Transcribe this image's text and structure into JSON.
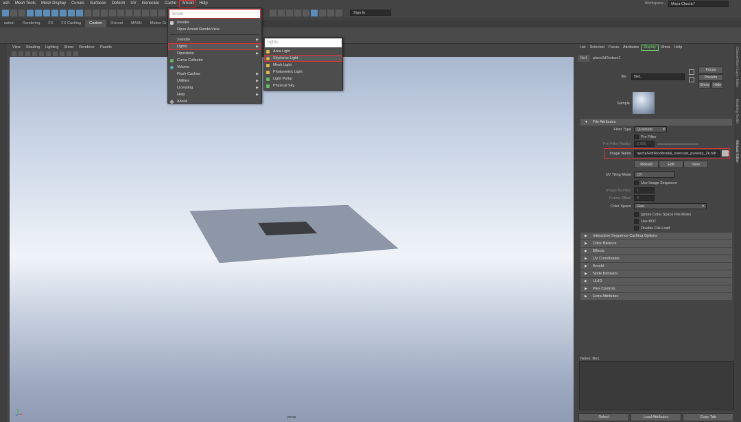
{
  "menubar": {
    "items": [
      "esh",
      "Mesh Tools",
      "Mesh Display",
      "Curves",
      "Surfaces",
      "Deform",
      "UV",
      "Generate",
      "Cache",
      "Arnold",
      "Help"
    ],
    "workspace_label": "Workspace :",
    "workspace_value": "Maya Classic*"
  },
  "toolbar": {
    "signin": "Sign In"
  },
  "shelf_tabs": [
    "eation",
    "Rendering",
    "FX",
    "FX Caching",
    "Custom",
    "Octrost",
    "MASH",
    "Motion Gr"
  ],
  "viewport": {
    "menu": [
      "View",
      "Shading",
      "Lighting",
      "Show",
      "Renderer",
      "Panels"
    ],
    "camera_label": "persp"
  },
  "arnold_menu": {
    "title": "Arnold",
    "items": [
      {
        "label": "Render",
        "icon": "render-icon",
        "arrow": false
      },
      {
        "label": "Open Arnold RenderView",
        "icon": "",
        "arrow": false
      },
      {
        "label": "StandIn",
        "icon": "",
        "arrow": true
      },
      {
        "label": "Lights",
        "icon": "",
        "arrow": true
      },
      {
        "label": "Operators",
        "icon": "",
        "arrow": true
      },
      {
        "label": "Curve Collector",
        "icon": "curve-icon",
        "arrow": false
      },
      {
        "label": "Volume",
        "icon": "volume-icon",
        "arrow": false
      },
      {
        "label": "Flush Caches",
        "icon": "",
        "arrow": true
      },
      {
        "label": "Utilities",
        "icon": "",
        "arrow": true
      },
      {
        "label": "Licensing",
        "icon": "",
        "arrow": true
      },
      {
        "label": "Help",
        "icon": "",
        "arrow": true
      },
      {
        "label": "About",
        "icon": "about-icon",
        "arrow": false
      }
    ]
  },
  "lights_menu": {
    "title": "Lights",
    "items": [
      {
        "label": "Area Light",
        "icon": "area-light-icon"
      },
      {
        "label": "Skydome Light",
        "icon": "skydome-light-icon"
      },
      {
        "label": "Mesh Light",
        "icon": "mesh-light-icon"
      },
      {
        "label": "Photometric Light",
        "icon": "photometric-light-icon"
      },
      {
        "label": "Light Portal",
        "icon": "light-portal-icon"
      },
      {
        "label": "Physical Sky",
        "icon": "physical-sky-icon"
      }
    ]
  },
  "attribute_editor": {
    "menu": [
      "List",
      "Selected",
      "Focus",
      "Attributes",
      "Display",
      "Show",
      "Help"
    ],
    "tabs": [
      "file1",
      "place2dTexture2"
    ],
    "file_label": "file:",
    "file_value": "file1",
    "focus": "Focus",
    "presets": "Presets",
    "show": "Show",
    "hide": "Hide",
    "sample_label": "Sample",
    "file_attributes": "File Attributes",
    "filter_type_label": "Filter Type",
    "filter_type_value": "Quadratic",
    "pre_filter": "Pre Filter",
    "pre_filter_radius_label": "Pre Filter Radius",
    "pre_filter_radius_value": "2.000",
    "image_name_label": "Image Name",
    "image_name_value": "ojects/Hdr/kloofendal_overcast_puresky_2k.hdr",
    "reload": "Reload",
    "edit": "Edit",
    "view": "View",
    "uv_tiling_label": "UV Tiling Mode",
    "uv_tiling_value": "Off",
    "use_image_sequence": "Use Image Sequence",
    "image_number_label": "Image Number",
    "image_number_value": "1",
    "frame_offset_label": "Frame Offset",
    "frame_offset_value": "0",
    "color_space_label": "Color Space",
    "color_space_value": "Raw",
    "ignore_cs": "Ignore Color Space File Rules",
    "use_bot": "Use BOT",
    "disable_file_load": "Disable File Load",
    "sections": [
      "Interactive Sequence Caching Options",
      "Color Balance",
      "Effects",
      "UV Coordinates",
      "Arnold",
      "Node Behavior",
      "UUID",
      "Plex Controls",
      "Extra Attributes"
    ],
    "notes_label": "Notes: file1",
    "bottom": [
      "Select",
      "Load Attributes",
      "Copy Tab"
    ],
    "side_tabs": [
      "Channel Box / Layer Editor",
      "Modeling Toolkit",
      "Attribute Editor"
    ]
  },
  "colors": {
    "highlight_red": "#e03030",
    "display_green": "#6cd26c"
  }
}
